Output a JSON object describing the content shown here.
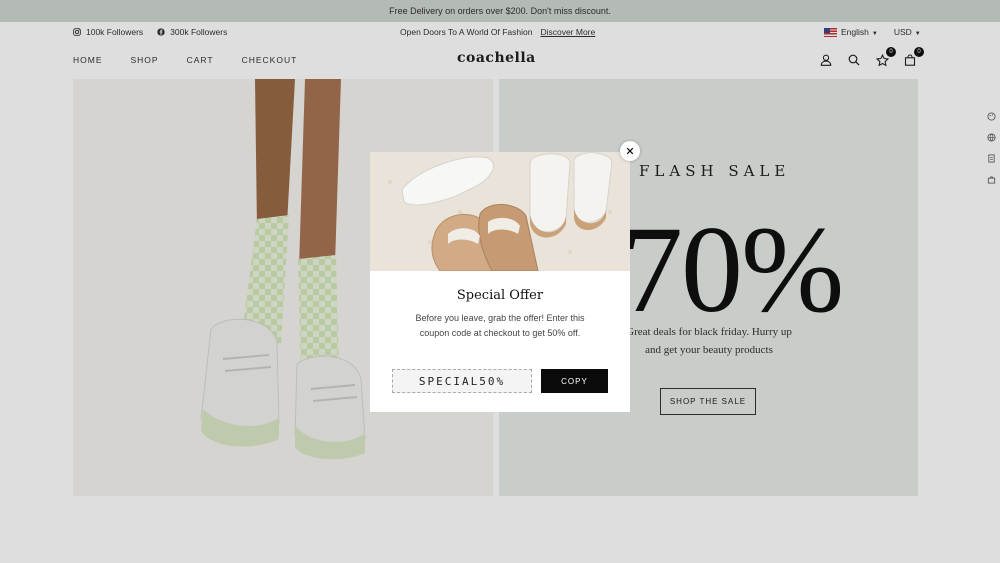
{
  "announcement": "Free Delivery on orders over $200. Don't miss discount.",
  "utility": {
    "instagram": "100k Followers",
    "facebook": "300k Followers",
    "promo": "Open Doors To A World Of Fashion",
    "discover": "Discover More",
    "language": "English",
    "currency": "USD"
  },
  "nav": {
    "menu": [
      "HOME",
      "SHOP",
      "CART",
      "CHECKOUT"
    ],
    "logo": "coachella",
    "wishlist_count": "0",
    "cart_count": "0"
  },
  "hero": {
    "flash": "FLASH SALE",
    "percent": "70%",
    "deals_line1": "Great deals for black friday. Hurry up",
    "deals_line2": "and get your beauty products",
    "cta": "SHOP THE SALE"
  },
  "modal": {
    "title": "Special Offer",
    "text": "Before you leave, grab the offer! Enter this coupon code at checkout to get 50% off.",
    "coupon": "SPECIAL50%",
    "copy": "COPY"
  },
  "icons": {
    "instagram": "instagram-icon",
    "facebook": "facebook-icon",
    "account": "user-icon",
    "search": "search-icon",
    "wishlist": "star-icon",
    "cart": "bag-icon",
    "close": "close-icon"
  },
  "colors": {
    "topbar": "#cfd6d1",
    "hero_right": "#e6ece7",
    "button": "#0a0a0a"
  }
}
